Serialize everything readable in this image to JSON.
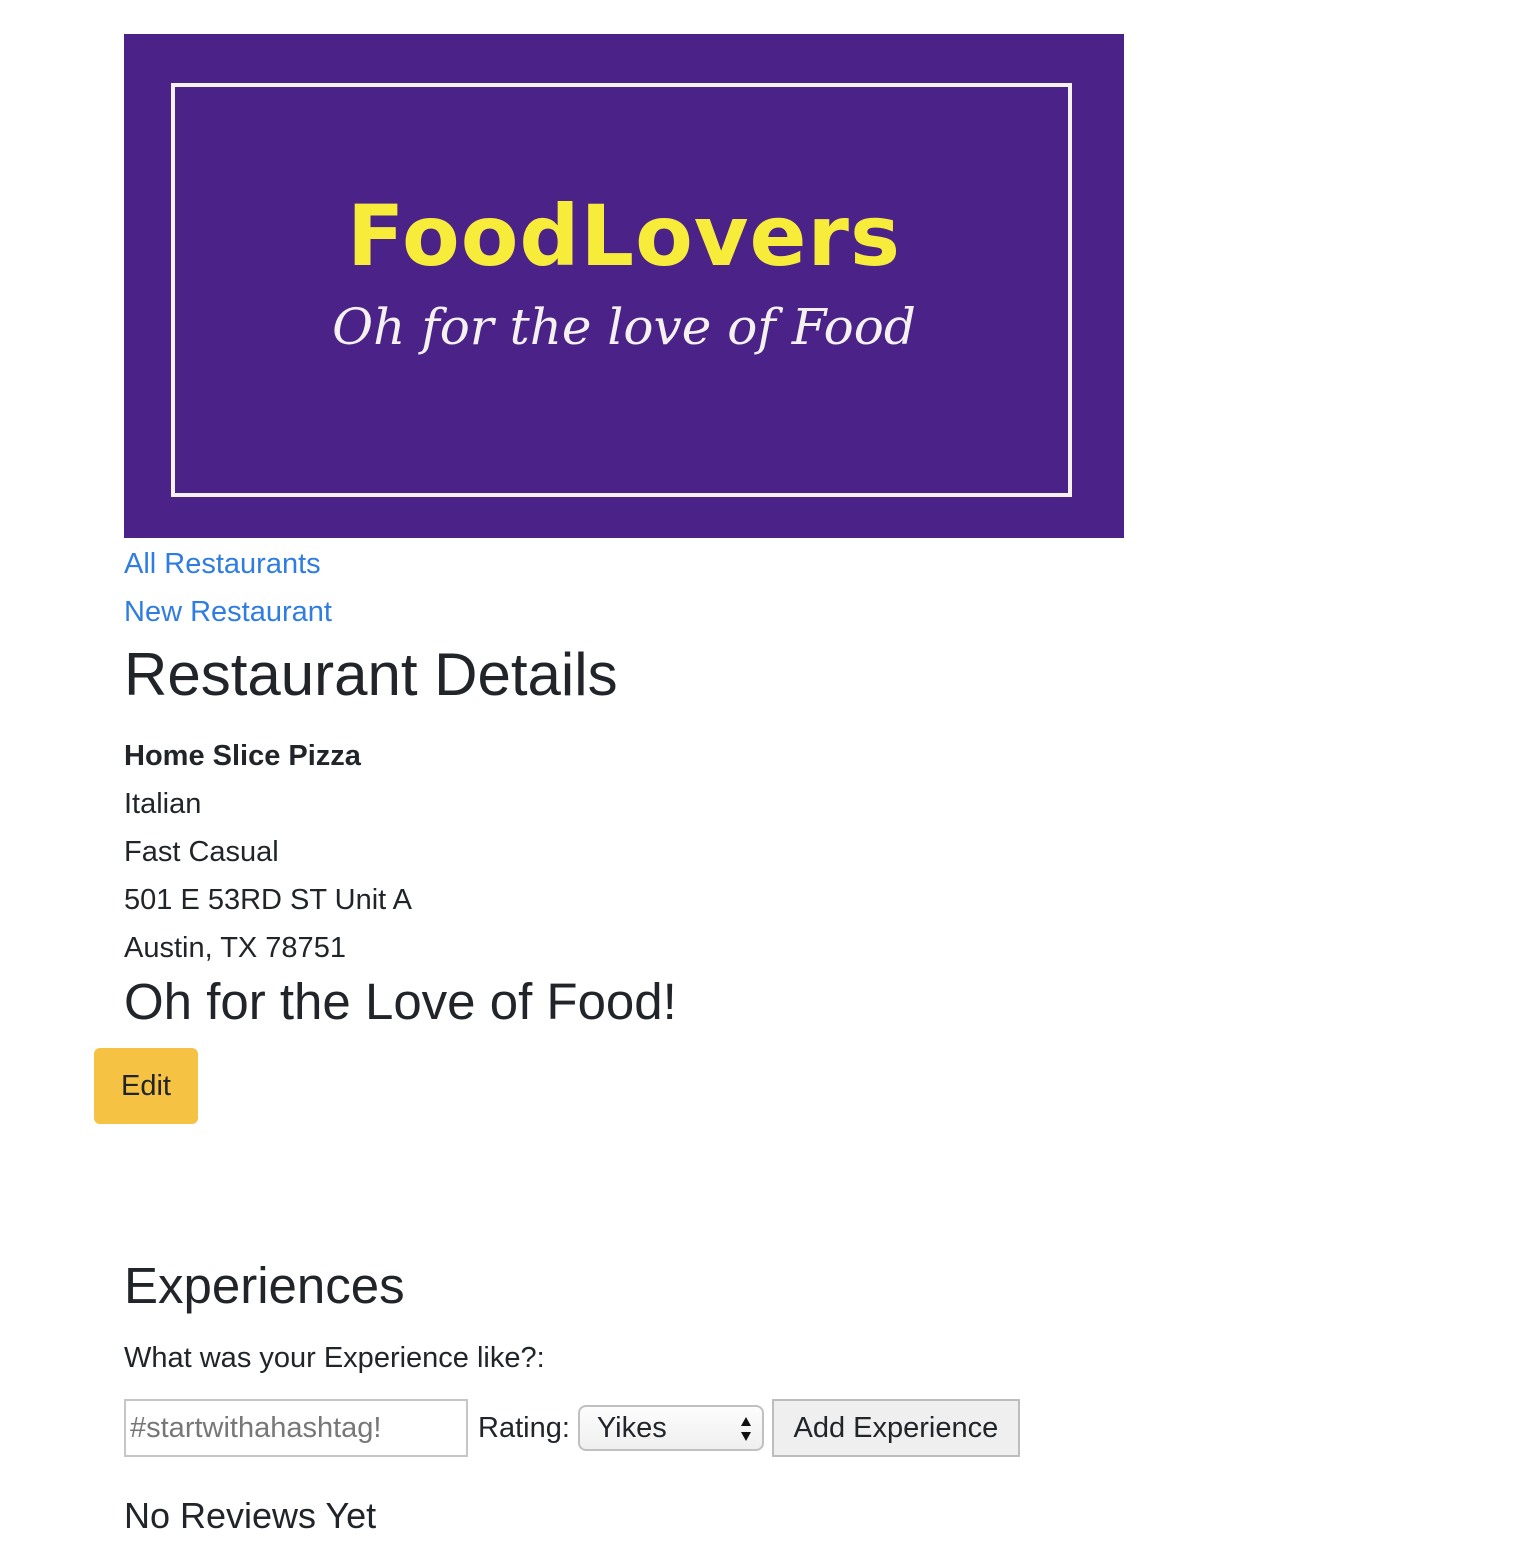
{
  "banner": {
    "title": "FoodLovers",
    "tagline": "Oh for the love of Food",
    "background_color": "#4b2388",
    "title_color": "#f7ec3a"
  },
  "nav": {
    "all_restaurants": "All Restaurants",
    "new_restaurant": "New Restaurant"
  },
  "page": {
    "title": "Restaurant Details"
  },
  "restaurant": {
    "name": "Home Slice Pizza",
    "cuisine": "Italian",
    "style": "Fast Casual",
    "address_line1": "501 E 53RD ST Unit A",
    "address_line2": "Austin, TX 78751",
    "slogan": "Oh for the Love of Food!"
  },
  "actions": {
    "edit_label": "Edit",
    "edit_color": "#f5c243"
  },
  "experiences": {
    "title": "Experiences",
    "prompt": "What was your Experience like?:",
    "input_placeholder": "#startwithahashtag!",
    "rating_label": "Rating:",
    "rating_selected": "Yikes",
    "submit_label": "Add Experience",
    "empty_message": "No Reviews Yet"
  }
}
